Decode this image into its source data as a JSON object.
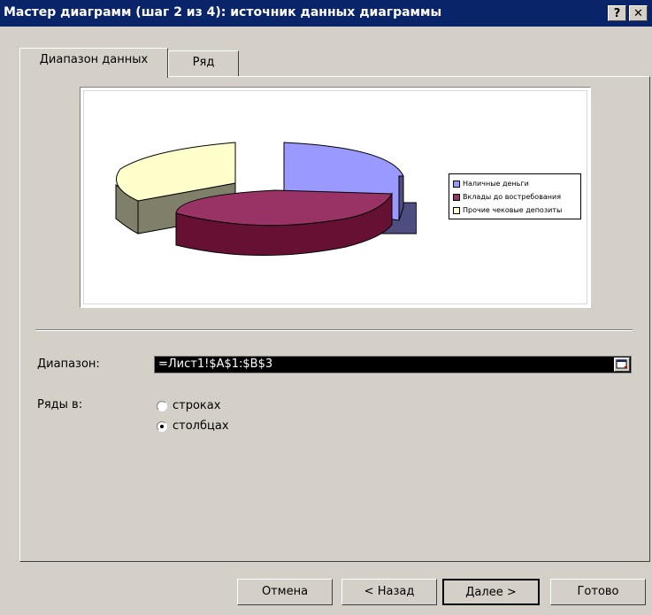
{
  "window": {
    "title": "Мастер диаграмм (шаг 2 из 4): источник данных диаграммы",
    "help_label": "?",
    "close_label": "✕"
  },
  "tabs": [
    {
      "label": "Диапазон данных",
      "active": true
    },
    {
      "label": "Ряд",
      "active": false
    }
  ],
  "chart_preview": {
    "legend": [
      {
        "label": "Наличные деньги",
        "color": "#9999ff"
      },
      {
        "label": "Вклады до востребования",
        "color": "#993366"
      },
      {
        "label": "Прочие чековые депозиты",
        "color": "#ffffcc"
      }
    ]
  },
  "range": {
    "label": "Диапазон:",
    "value": "=Лист1!$A$1:$B$3"
  },
  "series_in": {
    "label": "Ряды в:",
    "options": [
      {
        "label": "строках",
        "checked": false
      },
      {
        "label": "столбцах",
        "checked": true
      }
    ]
  },
  "buttons": {
    "cancel": "Отмена",
    "back": "< Назад",
    "next": "Далее >",
    "finish": "Готово"
  }
}
